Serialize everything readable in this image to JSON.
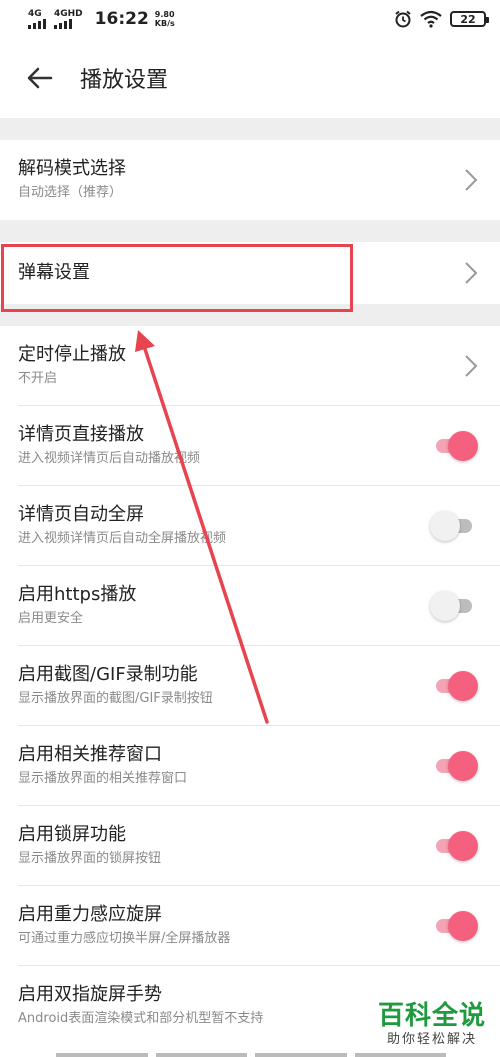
{
  "status_bar": {
    "net1": "4G",
    "net2": "4GHD",
    "time": "16:22",
    "speed_value": "9.80",
    "speed_unit": "KB/s",
    "battery": "22"
  },
  "header": {
    "title": "播放设置"
  },
  "settings": [
    {
      "title": "解码模式选择",
      "subtitle": "自动选择（推荐）",
      "control": "chevron"
    },
    {
      "title": "弹幕设置",
      "subtitle": "",
      "control": "chevron"
    },
    {
      "title": "定时停止播放",
      "subtitle": "不开启",
      "control": "chevron"
    },
    {
      "title": "详情页直接播放",
      "subtitle": "进入视频详情页后自动播放视频",
      "control": "toggle",
      "on": true
    },
    {
      "title": "详情页自动全屏",
      "subtitle": "进入视频详情页后自动全屏播放视频",
      "control": "toggle",
      "on": false
    },
    {
      "title": "启用https播放",
      "subtitle": "启用更安全",
      "control": "toggle",
      "on": false
    },
    {
      "title": "启用截图/GIF录制功能",
      "subtitle": "显示播放界面的截图/GIF录制按钮",
      "control": "toggle",
      "on": true
    },
    {
      "title": "启用相关推荐窗口",
      "subtitle": "显示播放界面的相关推荐窗口",
      "control": "toggle",
      "on": true
    },
    {
      "title": "启用锁屏功能",
      "subtitle": "显示播放界面的锁屏按钮",
      "control": "toggle",
      "on": true
    },
    {
      "title": "启用重力感应旋屏",
      "subtitle": "可通过重力感应切换半屏/全屏播放器",
      "control": "toggle",
      "on": true
    },
    {
      "title": "启用双指旋屏手势",
      "subtitle": "Android表面渲染模式和部分机型暂不支持",
      "control": "none"
    }
  ],
  "colors": {
    "toggle_on": "#f5607f",
    "toggle_off": "#f1f1f1",
    "annotation": "#e8444f",
    "watermark": "#1f9a3e"
  },
  "watermark": {
    "main": "百科全说",
    "sub": "助你轻松解决"
  }
}
